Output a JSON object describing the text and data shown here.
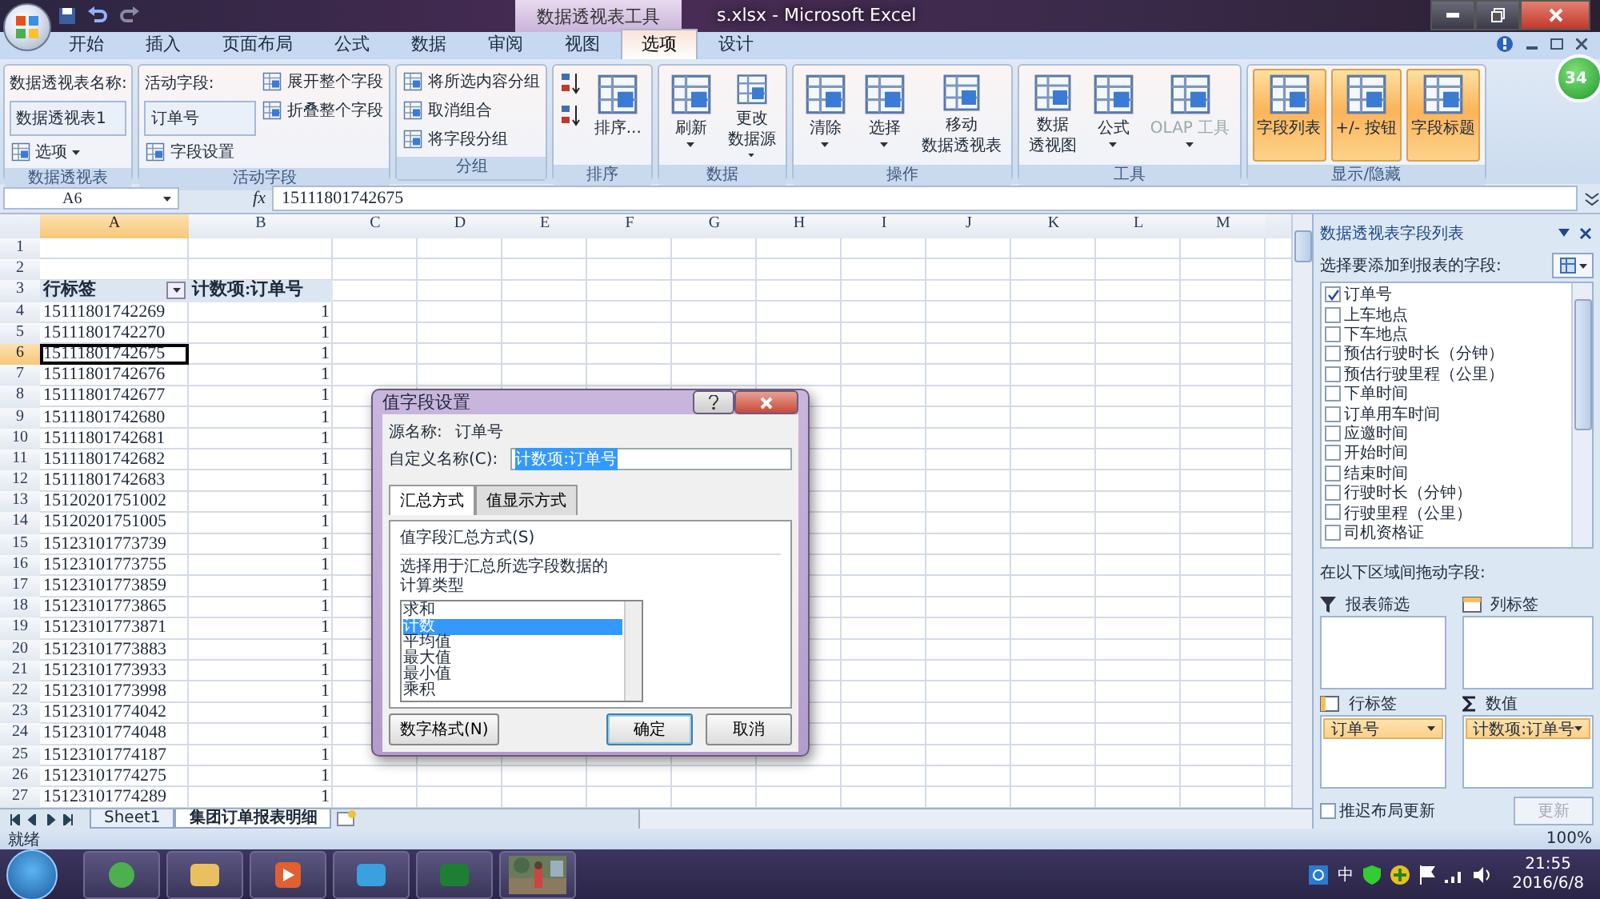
{
  "window": {
    "title": "s.xlsx - Microsoft Excel",
    "context_group": "数据透视表工具"
  },
  "ribbon_tabs": [
    {
      "label": "开始",
      "selected": false
    },
    {
      "label": "插入",
      "selected": false
    },
    {
      "label": "页面布局",
      "selected": false
    },
    {
      "label": "公式",
      "selected": false
    },
    {
      "label": "数据",
      "selected": false
    },
    {
      "label": "审阅",
      "selected": false
    },
    {
      "label": "视图",
      "selected": false
    },
    {
      "label": "选项",
      "selected": true
    },
    {
      "label": "设计",
      "selected": false
    }
  ],
  "ribbon_groups": [
    {
      "title": "数据透视表",
      "columns": [
        [
          {
            "kind": "label",
            "label": "数据透视表名称:"
          },
          {
            "kind": "field",
            "label": "数据透视表1"
          },
          {
            "kind": "small",
            "label": "选项",
            "dropdown": true
          }
        ]
      ]
    },
    {
      "title": "活动字段",
      "columns": [
        [
          {
            "kind": "label",
            "label": "活动字段:"
          },
          {
            "kind": "field",
            "label": "订单号"
          },
          {
            "kind": "small",
            "label": "字段设置"
          }
        ],
        [
          {
            "kind": "small",
            "label": "展开整个字段"
          },
          {
            "kind": "small",
            "label": "折叠整个字段"
          }
        ]
      ]
    },
    {
      "title": "分组",
      "columns": [
        [
          {
            "kind": "small",
            "label": "将所选内容分组"
          },
          {
            "kind": "small",
            "label": "取消组合"
          },
          {
            "kind": "small",
            "label": "将字段分组"
          }
        ]
      ]
    },
    {
      "title": "排序",
      "columns": [
        [
          {
            "kind": "icon"
          },
          {
            "kind": "icon"
          }
        ],
        [
          {
            "kind": "large",
            "label": "排序..."
          }
        ]
      ]
    },
    {
      "title": "数据",
      "columns": [
        [
          {
            "kind": "large",
            "label": "刷新",
            "dropdown": true
          }
        ],
        [
          {
            "kind": "large",
            "lines": [
              "更改",
              "数据源"
            ],
            "dropdown": true
          }
        ]
      ]
    },
    {
      "title": "操作",
      "columns": [
        [
          {
            "kind": "large",
            "label": "清除",
            "dropdown": true
          }
        ],
        [
          {
            "kind": "large",
            "label": "选择",
            "dropdown": true
          }
        ],
        [
          {
            "kind": "large",
            "lines": [
              "移动",
              "数据透视表"
            ]
          }
        ]
      ]
    },
    {
      "title": "工具",
      "columns": [
        [
          {
            "kind": "large",
            "lines": [
              "数据",
              "透视图"
            ]
          }
        ],
        [
          {
            "kind": "large",
            "label": "公式",
            "dropdown": true
          }
        ],
        [
          {
            "kind": "large",
            "label": "OLAP 工具",
            "dropdown": true,
            "disabled": true
          }
        ]
      ]
    },
    {
      "title": "显示/隐藏",
      "columns": [
        [
          {
            "kind": "large",
            "label": "字段列表",
            "on": true
          }
        ],
        [
          {
            "kind": "large",
            "label": "+/- 按钮",
            "on": true
          }
        ],
        [
          {
            "kind": "large",
            "label": "字段标题",
            "on": true
          }
        ]
      ]
    }
  ],
  "floating_badge": "34",
  "formula_bar": {
    "name_box": "A6",
    "function_label": "fx",
    "value": "15111801742675"
  },
  "sheet": {
    "columns": [
      {
        "label": "A",
        "selected": true
      },
      {
        "label": "B",
        "selected": false
      },
      {
        "label": "C",
        "selected": false
      },
      {
        "label": "D",
        "selected": false
      },
      {
        "label": "E",
        "selected": false
      },
      {
        "label": "F",
        "selected": false
      },
      {
        "label": "G",
        "selected": false
      },
      {
        "label": "H",
        "selected": false
      },
      {
        "label": "I",
        "selected": false
      },
      {
        "label": "J",
        "selected": false
      },
      {
        "label": "K",
        "selected": false
      },
      {
        "label": "L",
        "selected": false
      },
      {
        "label": "M",
        "selected": false
      }
    ],
    "rows": [
      {
        "number": "1",
        "selected": false
      },
      {
        "number": "2",
        "selected": false
      },
      {
        "number": "3",
        "selected": false,
        "kind": "header",
        "cells": [
          "行标签",
          "计数项:订单号"
        ]
      },
      {
        "number": "4",
        "selected": false,
        "cells": [
          "15111801742269",
          "1"
        ]
      },
      {
        "number": "5",
        "selected": false,
        "cells": [
          "15111801742270",
          "1"
        ]
      },
      {
        "number": "6",
        "selected": true,
        "cells": [
          "15111801742675",
          "1"
        ]
      },
      {
        "number": "7",
        "selected": false,
        "cells": [
          "15111801742676",
          "1"
        ]
      },
      {
        "number": "8",
        "selected": false,
        "cells": [
          "15111801742677",
          "1"
        ]
      },
      {
        "number": "9",
        "selected": false,
        "cells": [
          "15111801742680",
          "1"
        ]
      },
      {
        "number": "10",
        "selected": false,
        "cells": [
          "15111801742681",
          "1"
        ]
      },
      {
        "number": "11",
        "selected": false,
        "cells": [
          "15111801742682",
          "1"
        ]
      },
      {
        "number": "12",
        "selected": false,
        "cells": [
          "15111801742683",
          "1"
        ]
      },
      {
        "number": "13",
        "selected": false,
        "cells": [
          "15120201751002",
          "1"
        ]
      },
      {
        "number": "14",
        "selected": false,
        "cells": [
          "15120201751005",
          "1"
        ]
      },
      {
        "number": "15",
        "selected": false,
        "cells": [
          "15123101773739",
          "1"
        ]
      },
      {
        "number": "16",
        "selected": false,
        "cells": [
          "15123101773755",
          "1"
        ]
      },
      {
        "number": "17",
        "selected": false,
        "cells": [
          "15123101773859",
          "1"
        ]
      },
      {
        "number": "18",
        "selected": false,
        "cells": [
          "15123101773865",
          "1"
        ]
      },
      {
        "number": "19",
        "selected": false,
        "cells": [
          "15123101773871",
          "1"
        ]
      },
      {
        "number": "20",
        "selected": false,
        "cells": [
          "15123101773883",
          "1"
        ]
      },
      {
        "number": "21",
        "selected": false,
        "cells": [
          "15123101773933",
          "1"
        ]
      },
      {
        "number": "22",
        "selected": false,
        "cells": [
          "15123101773998",
          "1"
        ]
      },
      {
        "number": "23",
        "selected": false,
        "cells": [
          "15123101774042",
          "1"
        ]
      },
      {
        "number": "24",
        "selected": false,
        "cells": [
          "15123101774048",
          "1"
        ]
      },
      {
        "number": "25",
        "selected": false,
        "cells": [
          "15123101774187",
          "1"
        ]
      },
      {
        "number": "26",
        "selected": false,
        "cells": [
          "15123101774275",
          "1"
        ]
      },
      {
        "number": "27",
        "selected": false,
        "cells": [
          "15123101774289",
          "1"
        ]
      }
    ]
  },
  "sheet_tabs": [
    {
      "label": "Sheet1",
      "selected": false
    },
    {
      "label": "集团订单报表明细",
      "selected": true
    }
  ],
  "dialog": {
    "title": "值字段设置",
    "source_label": "源名称:",
    "source_value": "订单号",
    "name_label": "自定义名称(C):",
    "name_value": "计数项:订单号",
    "tabs": [
      {
        "label": "汇总方式",
        "selected": true
      },
      {
        "label": "值显示方式",
        "selected": false
      }
    ],
    "section_title": "值字段汇总方式(S)",
    "description": "选择用于汇总所选字段数据的计算类型",
    "functions": [
      {
        "label": "求和",
        "selected": false
      },
      {
        "label": "计数",
        "selected": true
      },
      {
        "label": "平均值",
        "selected": false
      },
      {
        "label": "最大值",
        "selected": false
      },
      {
        "label": "最小值",
        "selected": false
      },
      {
        "label": "乘积",
        "selected": false
      }
    ],
    "buttons": [
      {
        "label": "数字格式(N)",
        "kind": "left"
      },
      {
        "label": "确定",
        "kind": "default"
      },
      {
        "label": "取消",
        "kind": "normal"
      }
    ]
  },
  "field_list": {
    "title": "数据透视表字段列表",
    "prompt": "选择要添加到报表的字段:",
    "fields": [
      {
        "label": "订单号",
        "checked": true
      },
      {
        "label": "上车地点",
        "checked": false
      },
      {
        "label": "下车地点",
        "checked": false
      },
      {
        "label": "预估行驶时长（分钟）",
        "checked": false
      },
      {
        "label": "预估行驶里程（公里）",
        "checked": false
      },
      {
        "label": "下单时间",
        "checked": false
      },
      {
        "label": "订单用车时间",
        "checked": false
      },
      {
        "label": "应邀时间",
        "checked": false
      },
      {
        "label": "开始时间",
        "checked": false
      },
      {
        "label": "结束时间",
        "checked": false
      },
      {
        "label": "行驶时长（分钟）",
        "checked": false
      },
      {
        "label": "行驶里程（公里）",
        "checked": false
      },
      {
        "label": "司机资格证",
        "checked": false
      }
    ],
    "drag_prompt": "在以下区域间拖动字段:",
    "areas": [
      {
        "title": "报表筛选",
        "kind": "filter"
      },
      {
        "title": "列标签",
        "kind": "columns"
      },
      {
        "title": "行标签",
        "kind": "rows",
        "items": [
          "订单号"
        ]
      },
      {
        "title": "数值",
        "kind": "values",
        "items": [
          "计数项:订单号"
        ]
      }
    ],
    "defer": {
      "label": "推迟布局更新",
      "checked": false
    },
    "update_button": {
      "label": "更新",
      "disabled": true
    }
  },
  "status_bar": {
    "text": "就绪",
    "zoom": "100%"
  },
  "taskbar": {
    "ime": "中",
    "time": "21:55",
    "date": "2016/6/8"
  }
}
